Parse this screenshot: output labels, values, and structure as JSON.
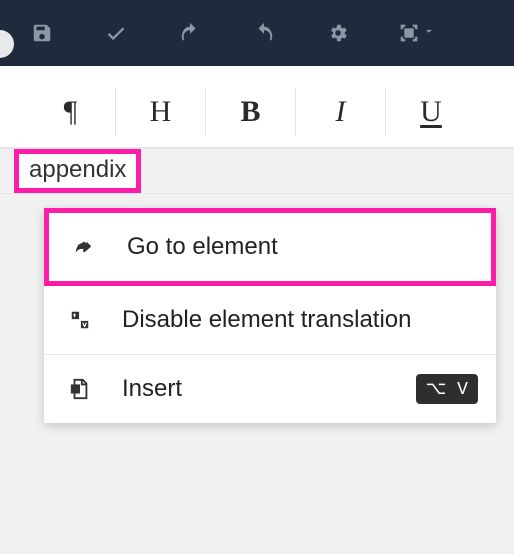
{
  "colors": {
    "toolbar_bg": "#1f2b3c",
    "highlight": "#ff1ca8",
    "icon_muted": "#8c96a5"
  },
  "top_toolbar": {
    "save": "save",
    "ok": "confirm",
    "undo": "undo",
    "redo": "redo",
    "settings": "settings",
    "fullscreen": "fullscreen"
  },
  "format_toolbar": {
    "paragraph": "¶",
    "heading": "H",
    "bold": "B",
    "italic": "I",
    "underline": "U"
  },
  "breadcrumb": {
    "tag": "appendix"
  },
  "context_menu": {
    "items": [
      {
        "icon": "goto-icon",
        "label": "Go to element",
        "shortcut": null
      },
      {
        "icon": "translate-off-icon",
        "label": "Disable element translation",
        "shortcut": null
      },
      {
        "icon": "insert-icon",
        "label": "Insert",
        "shortcut": "⌥ V"
      }
    ]
  }
}
